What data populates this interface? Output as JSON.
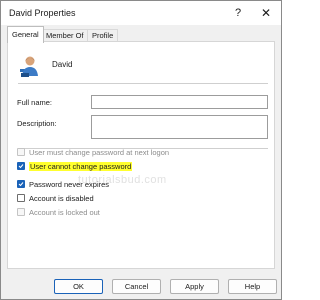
{
  "window": {
    "title": "David Properties",
    "help_label": "?",
    "close_label": "✕"
  },
  "tabs": [
    {
      "label": "General",
      "active": true
    },
    {
      "label": "Member Of",
      "active": false
    },
    {
      "label": "Profile",
      "active": false
    }
  ],
  "user": {
    "name": "David",
    "icon": "user-icon"
  },
  "fields": {
    "full_name_label": "Full name:",
    "full_name_value": "",
    "description_label": "Description:",
    "description_value": ""
  },
  "watermark": "tutorialsbud.com",
  "checkboxes": [
    {
      "label": "User must change password at next logon",
      "checked": false,
      "enabled": false,
      "highlighted": false
    },
    {
      "label": "User cannot change password",
      "checked": true,
      "enabled": true,
      "highlighted": true
    },
    {
      "label": "Password never expires",
      "checked": true,
      "enabled": true,
      "highlighted": false
    },
    {
      "label": "Account is disabled",
      "checked": false,
      "enabled": true,
      "highlighted": false
    },
    {
      "label": "Account is locked out",
      "checked": false,
      "enabled": false,
      "highlighted": false
    }
  ],
  "buttons": {
    "ok": "OK",
    "cancel": "Cancel",
    "apply": "Apply",
    "help": "Help"
  },
  "colors": {
    "accent": "#1a62b8",
    "highlight": "#ffff2e"
  }
}
